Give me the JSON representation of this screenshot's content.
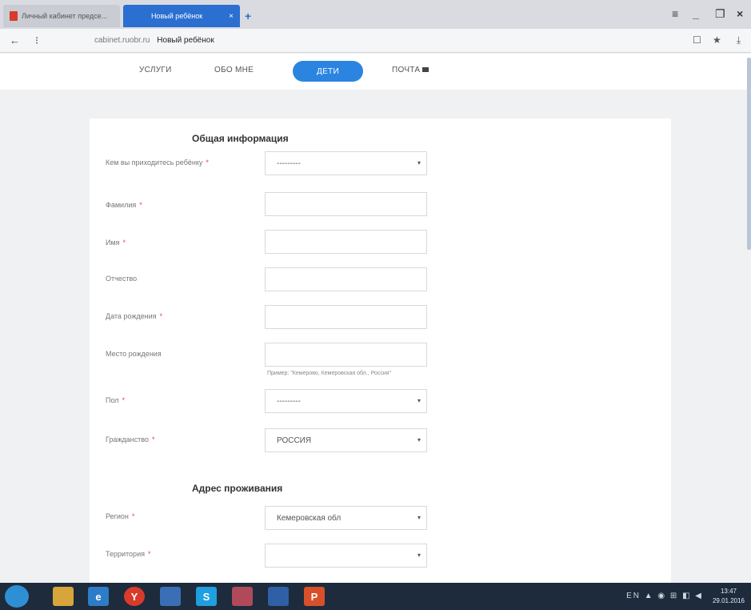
{
  "browser": {
    "tabs": [
      {
        "label": "Личный кабинет предсе...",
        "active": false
      },
      {
        "label": "Новый ребёнок",
        "active": true
      }
    ],
    "new_tab_symbol": "+",
    "window_controls": [
      "≡",
      "_",
      "❐",
      "×"
    ],
    "nav_back": "←",
    "nav_icon": "⁝",
    "url": "cabinet.ruobr.ru",
    "page_name": "Новый ребёнок",
    "addr_right": [
      "☐",
      "★",
      "⤓"
    ]
  },
  "site_nav": {
    "items": [
      {
        "label": "УСЛУГИ",
        "active": false
      },
      {
        "label": "ОБО МНЕ",
        "active": false
      },
      {
        "label": "ДЕТИ",
        "active": true
      },
      {
        "label": "ПОЧТА",
        "active": false,
        "icon": "mail-icon"
      }
    ]
  },
  "form": {
    "required_mark": "*",
    "select_arrow": "▾",
    "section_general": "Общая информация",
    "relation": {
      "label": "Кем вы приходитесь ребёнку",
      "required": true,
      "value": "---------"
    },
    "last_name": {
      "label": "Фамилия",
      "required": true,
      "value": ""
    },
    "first_name": {
      "label": "Имя",
      "required": true,
      "value": ""
    },
    "patronymic": {
      "label": "Отчество",
      "required": false,
      "value": ""
    },
    "birth_date": {
      "label": "Дата рождения",
      "required": true,
      "value": ""
    },
    "birth_place": {
      "label": "Место рождения",
      "required": false,
      "value": "",
      "hint": "Пример: \"Кемерово, Кемеровская обл., Россия\""
    },
    "gender": {
      "label": "Пол",
      "required": true,
      "value": "---------"
    },
    "citizenship": {
      "label": "Гражданство",
      "required": true,
      "value": "РОССИЯ"
    },
    "section_address": "Адрес проживания",
    "region": {
      "label": "Регион",
      "required": true,
      "value": "Кемеровская обл"
    },
    "territory": {
      "label": "Территория",
      "required": true,
      "value": ""
    }
  },
  "taskbar": {
    "apps": [
      "",
      "e",
      "Y",
      "",
      "S",
      "",
      "",
      "P"
    ],
    "tray": "EN ▲ ◉ ⊞ ◧ ◀",
    "clock_time": "13:47",
    "clock_date": "29.01.2016"
  }
}
